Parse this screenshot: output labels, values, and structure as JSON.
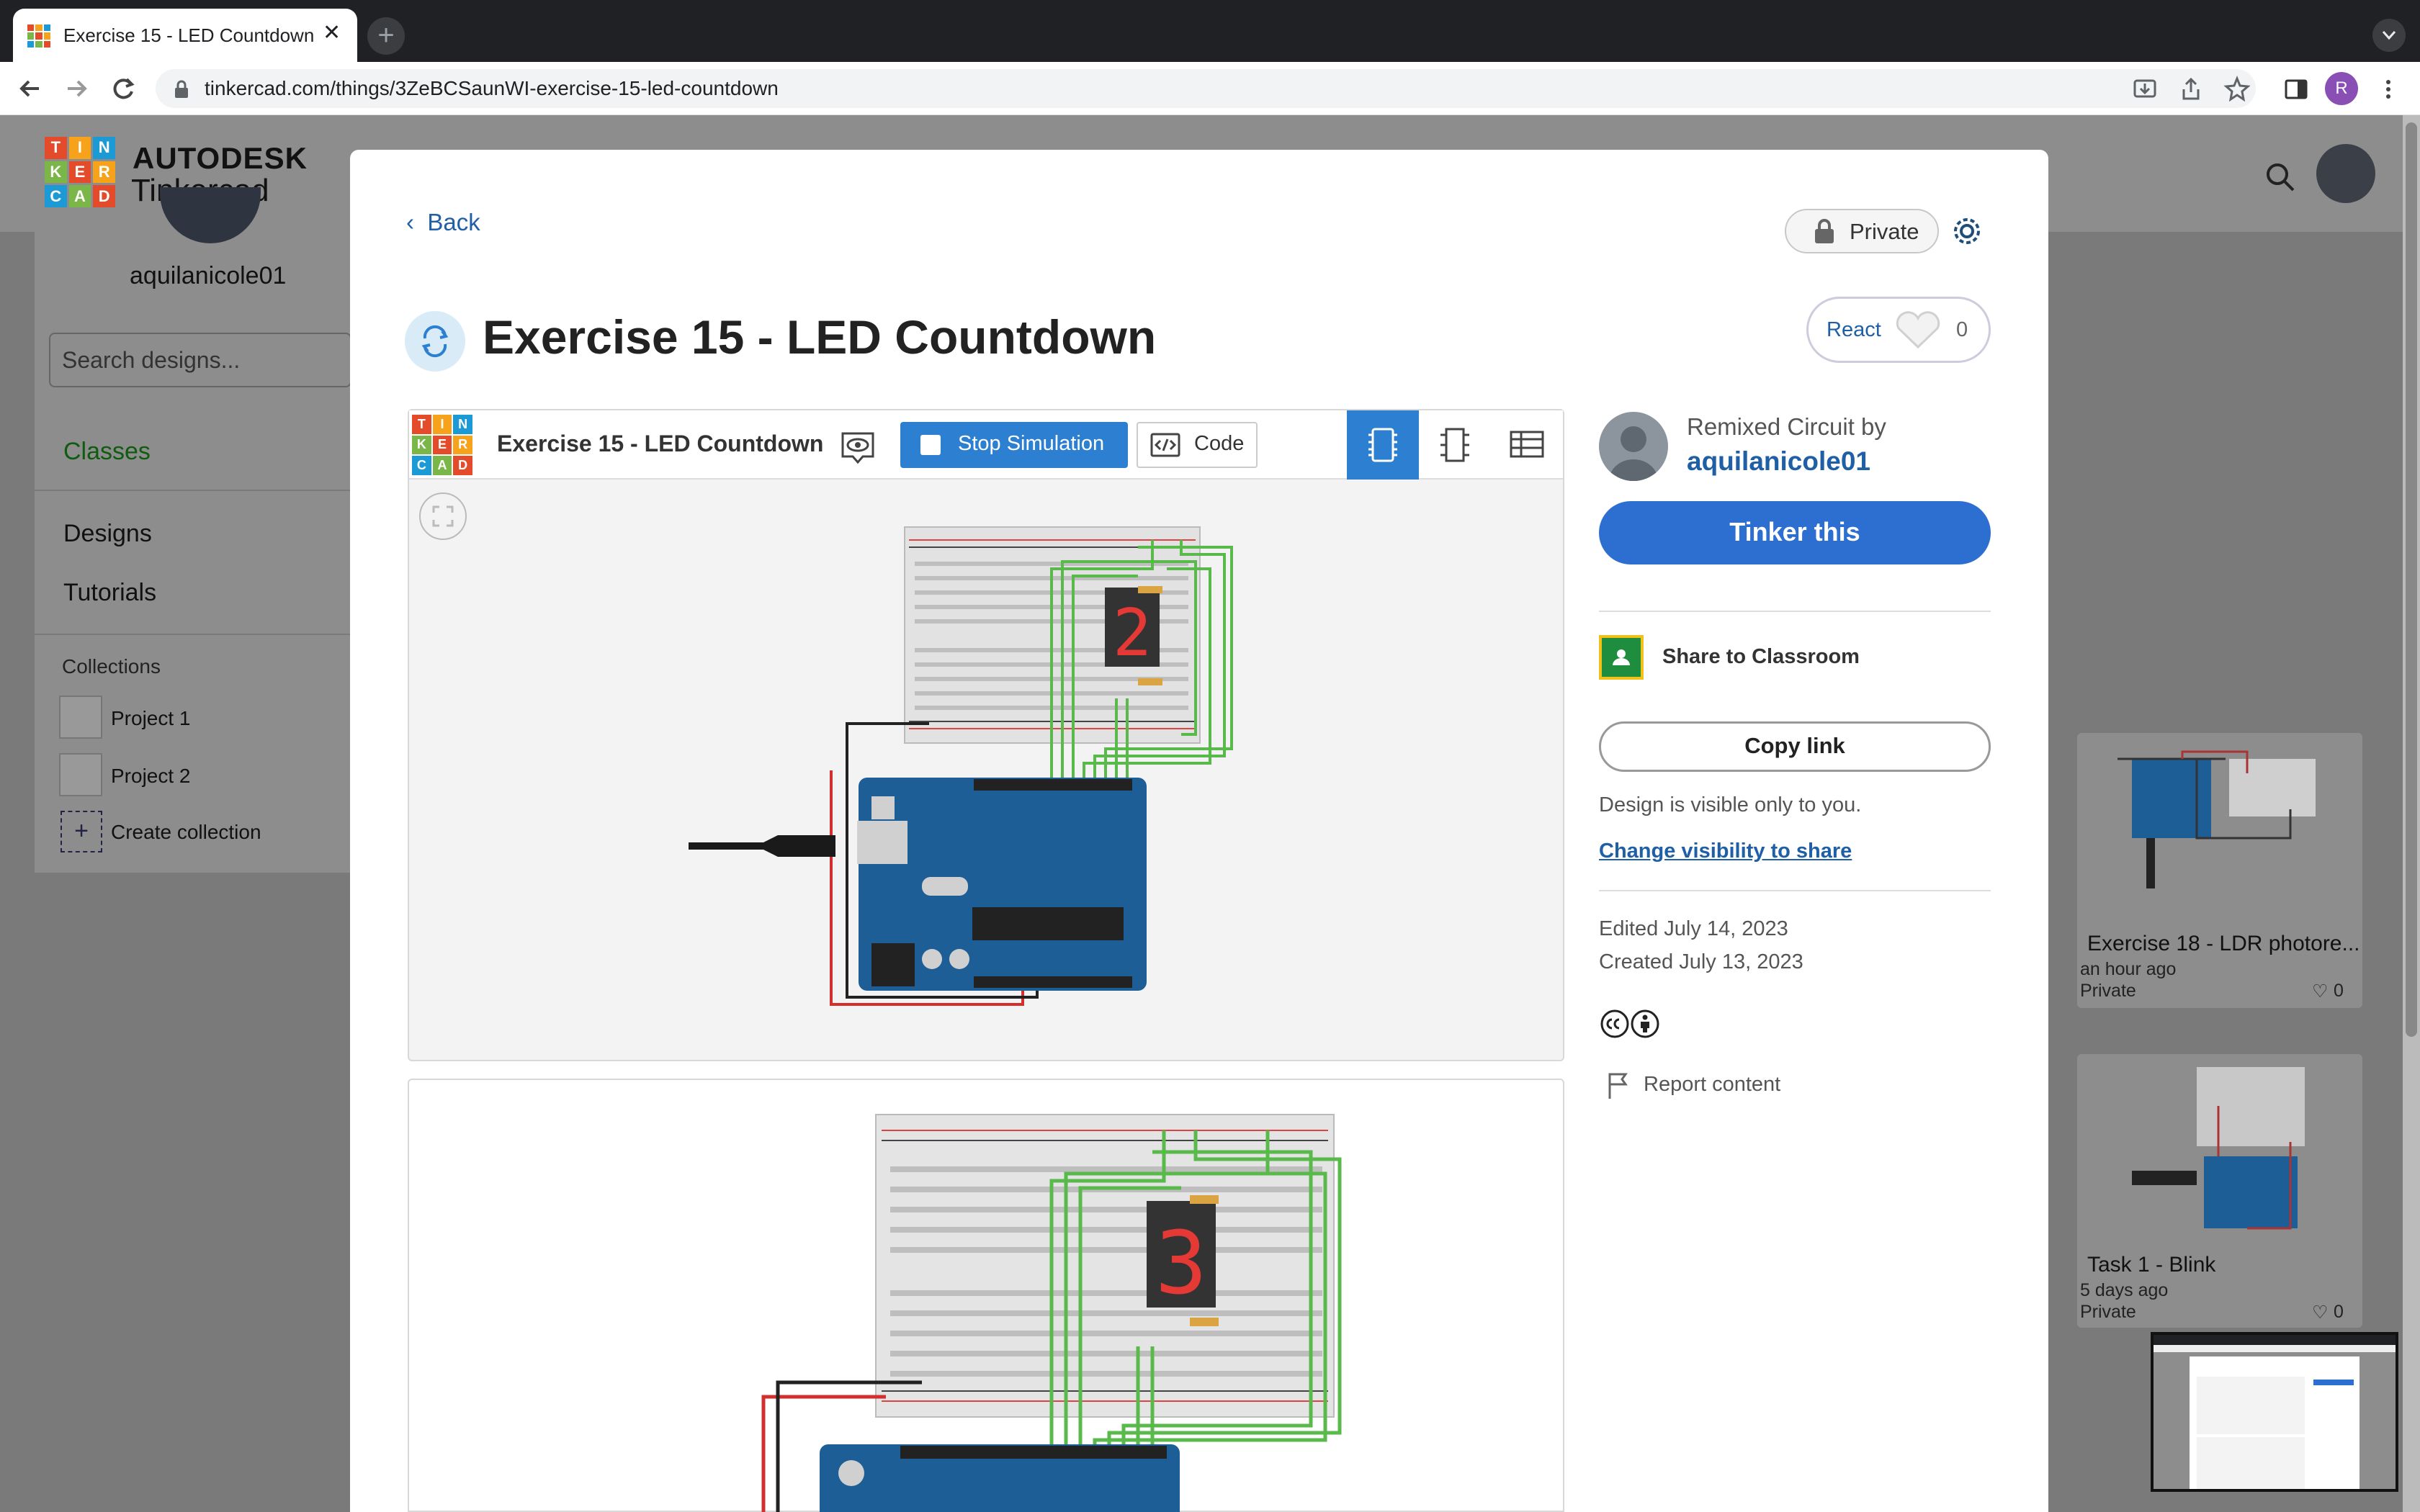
{
  "browser": {
    "tab_title": "Exercise 15 - LED Countdown",
    "url": "tinkercad.com/things/3ZeBCSaunWI-exercise-15-led-countdown",
    "profile_initial": "R"
  },
  "header": {
    "brand_top": "AUTODESK",
    "brand_bottom": "Tinkercad",
    "logo_letters": [
      "T",
      "I",
      "N",
      "K",
      "E",
      "R",
      "C",
      "A",
      "D"
    ]
  },
  "sidebar": {
    "username": "aquilanicole01",
    "search_placeholder": "Search designs...",
    "nav": {
      "classes": "Classes",
      "designs": "Designs",
      "tutorials": "Tutorials"
    },
    "collections_label": "Collections",
    "collections": [
      "Project 1",
      "Project 2"
    ],
    "create_collection": "Create collection"
  },
  "right_cards": [
    {
      "title": "Exercise 18 - LDR photore...",
      "time": "an hour ago",
      "visibility": "Private",
      "likes": "0"
    },
    {
      "title": "Task 1 - Blink",
      "time": "5 days ago",
      "visibility": "Private",
      "likes": "0"
    }
  ],
  "modal": {
    "back": "Back",
    "private": "Private",
    "title": "Exercise 15 - LED Countdown",
    "react": {
      "label": "React",
      "count": "0"
    },
    "viewer": {
      "title": "Exercise 15 - LED Countdown",
      "stop_simulation": "Stop Simulation",
      "code": "Code",
      "display_digit_1": "2",
      "display_digit_2": "3"
    },
    "sidebar": {
      "remixed_by": "Remixed Circuit by",
      "author": "aquilanicole01",
      "tinker_this": "Tinker this",
      "share_classroom": "Share to Classroom",
      "copy_link": "Copy link",
      "visibility_text": "Design is visible only to you.",
      "change_visibility": "Change visibility to share",
      "edited": "Edited July 14, 2023",
      "created": "Created July 13, 2023",
      "report": "Report content"
    }
  },
  "colors": {
    "accent_blue": "#2d7fd1",
    "link_blue": "#1f5fa6",
    "classes_green": "#0f5b0f",
    "logo_tiles": [
      "#e44b2a",
      "#f7a21b",
      "#1c9ad6",
      "#7ab648",
      "#e44b2a",
      "#f7a21b",
      "#1c9ad6",
      "#7ab648",
      "#e44b2a"
    ]
  }
}
